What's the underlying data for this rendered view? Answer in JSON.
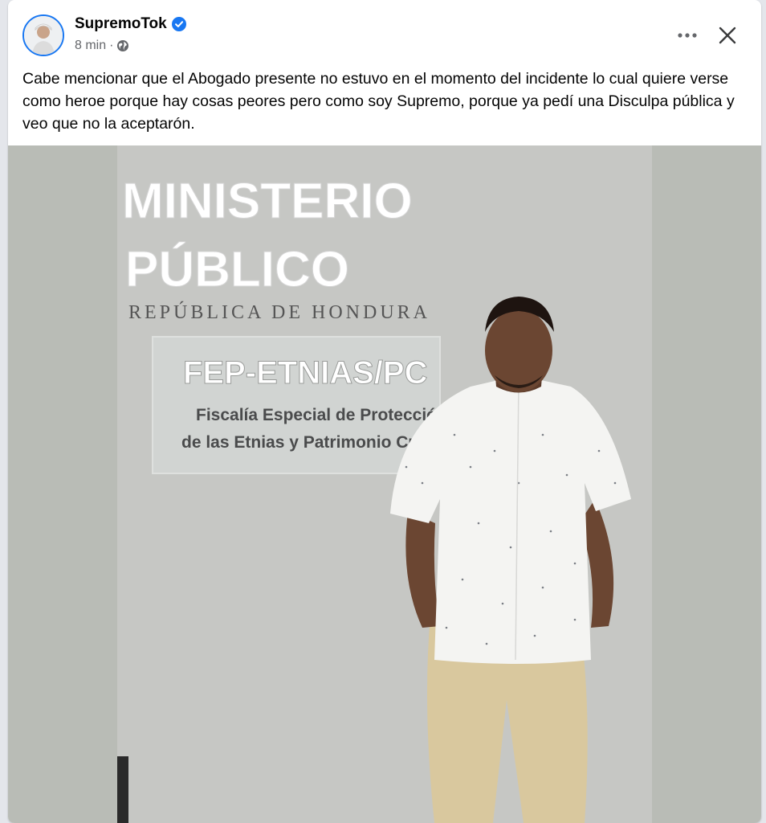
{
  "post": {
    "author": "SupremoTok",
    "time": "8 min",
    "separator": "·",
    "text": "Cabe mencionar que el Abogado presente no estuvo en el momento del incidente lo cual quiere verse como heroe porque hay cosas peores pero como soy Supremo, porque ya pedí una Disculpa pública y veo que no la aceptarón."
  },
  "photo": {
    "sign_line1": "MINISTERIO",
    "sign_line2": "PÚBLICO",
    "sign_line3": "REPÚBLICA DE HONDURA",
    "plaque_title": "FEP-ETNIAS/PC",
    "plaque_line1": "Fiscalía Especial de Protección",
    "plaque_line2": "de las Etnias y Patrimonio Cultu"
  },
  "icons": {
    "verified": "verified-badge-icon",
    "privacy": "globe-icon",
    "more": "more-horizontal-icon",
    "close": "close-icon"
  },
  "colors": {
    "accent": "#1877f2",
    "secondary_text": "#65676b",
    "wall": "#b9bcb6"
  }
}
